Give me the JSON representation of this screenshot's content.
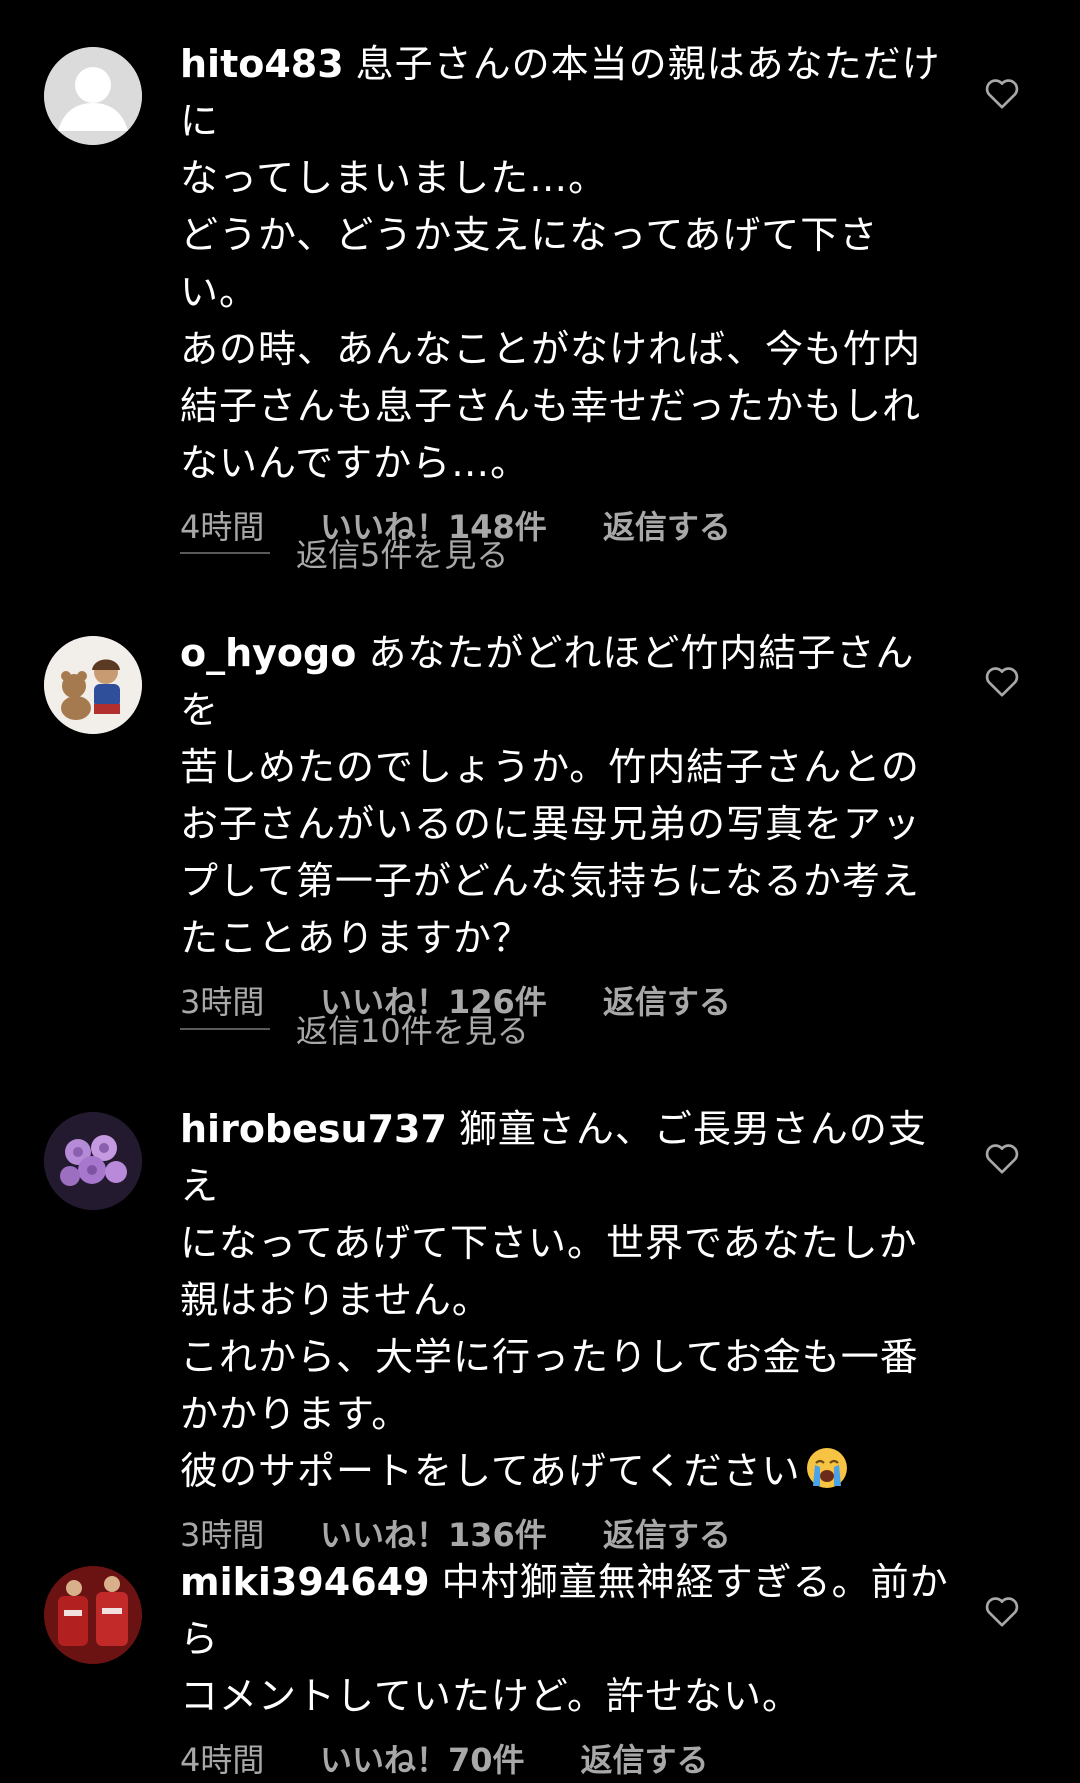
{
  "comments": [
    {
      "username": "hito483",
      "text": "息子さんの本当の親はあなただけに\nなってしまいました…。\nどうか、どうか支えになってあげて下さ\nい。\nあの時、あんなことがなければ、今も竹内\n結子さんも息子さんも幸せだったかもしれ\nないんですから…。",
      "time": "4時間",
      "likes": "いいね！148件",
      "reply": "返信する",
      "view_replies": "返信5件を見る"
    },
    {
      "username": "o_hyogo",
      "text": "あなたがどれほど竹内結子さんを\n苦しめたのでしょうか。竹内結子さんとの\nお子さんがいるのに異母兄弟の写真をアッ\nプして第一子がどんな気持ちになるか考え\nたことありますか？",
      "time": "3時間",
      "likes": "いいね！126件",
      "reply": "返信する",
      "view_replies": "返信10件を見る"
    },
    {
      "username": "hirobesu737",
      "text": "獅童さん、ご長男さんの支え\nになってあげて下さい。世界であなたしか\n親はおりません。\nこれから、大学に行ったりしてお金も一番\nかかります。\n彼のサポートをしてあげてください",
      "emoji": "loudly-crying-face-emoji",
      "time": "3時間",
      "likes": "いいね！136件",
      "reply": "返信する"
    },
    {
      "username": "miki394649",
      "text": "中村獅童無神経すぎる。前から\nコメントしていたけど。許せない。",
      "time": "4時間",
      "likes": "いいね！70件",
      "reply": "返信する"
    }
  ],
  "colors": {
    "background": "#000000",
    "text": "#ffffff",
    "meta": "#a8a8a8"
  }
}
